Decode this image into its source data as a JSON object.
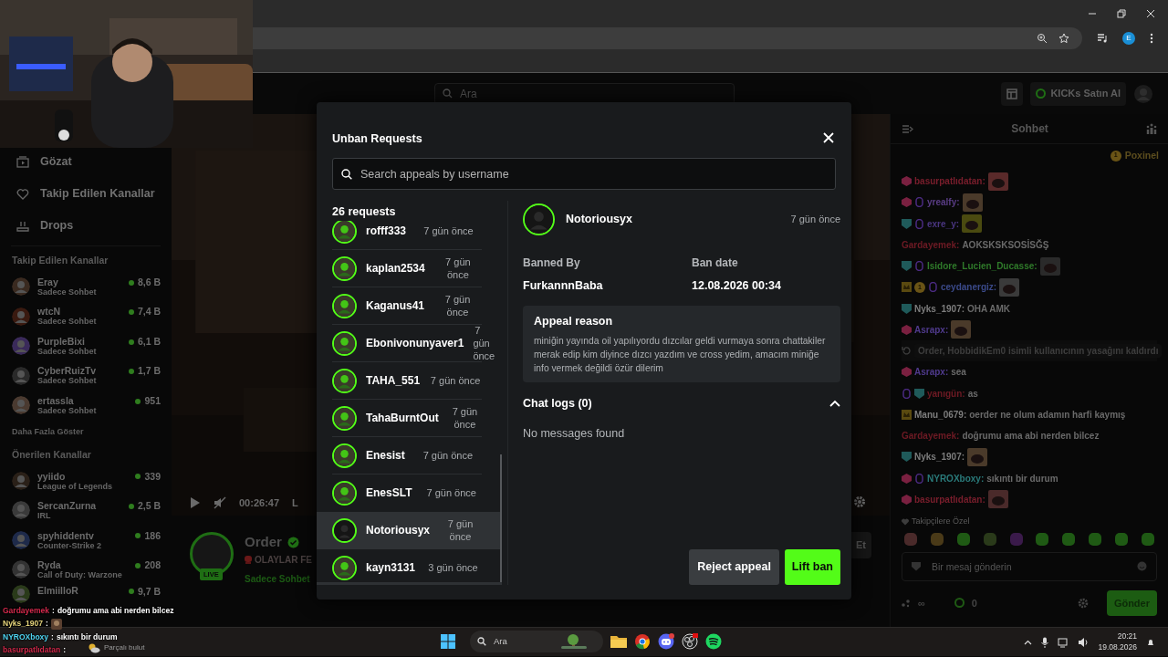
{
  "browser": {
    "profile_initial": "E"
  },
  "site_header": {
    "search_placeholder": "Ara",
    "kicks_button": "KICKs Satın Al"
  },
  "sidebar": {
    "nav": [
      {
        "kind": "browse",
        "label": "Gözat"
      },
      {
        "kind": "following",
        "label": "Takip Edilen Kanallar"
      },
      {
        "kind": "drops",
        "label": "Drops"
      }
    ],
    "followed_title": "Takip Edilen Kanallar",
    "followed": [
      {
        "name": "Eray",
        "subtitle": "Sadece Sohbet",
        "viewers": "8,6 B"
      },
      {
        "name": "wtcN",
        "subtitle": "Sadece Sohbet",
        "viewers": "7,4 B"
      },
      {
        "name": "PurpleBixi",
        "subtitle": "Sadece Sohbet",
        "viewers": "6,1 B"
      },
      {
        "name": "CyberRuizTv",
        "subtitle": "Sadece Sohbet",
        "viewers": "1,7 B"
      },
      {
        "name": "ertassla",
        "subtitle": "Sadece Sohbet",
        "viewers": "951"
      }
    ],
    "show_more": "Daha Fazla Göster",
    "recommended_title": "Önerilen Kanallar",
    "recommended": [
      {
        "name": "yyiido",
        "subtitle": "League of Legends",
        "viewers": "339"
      },
      {
        "name": "SercanZurna",
        "subtitle": "IRL",
        "viewers": "2,5 B"
      },
      {
        "name": "spyhiddentv",
        "subtitle": "Counter-Strike 2",
        "viewers": "186"
      },
      {
        "name": "Ryda",
        "subtitle": "Call of Duty: Warzone",
        "viewers": "208"
      },
      {
        "name": "ElmiilloR",
        "viewers": "9,7 B"
      }
    ]
  },
  "player": {
    "time": "00:26:47",
    "live_fragment": "L"
  },
  "channel": {
    "name": "Order",
    "verified": true,
    "title": "OLAYLAR FE",
    "category": "Sadece Sohbet",
    "live_badge": "LIVE",
    "follow_fragment": "Et"
  },
  "chat": {
    "title": "Sohbet",
    "pinned": {
      "badge": "1",
      "user": "Poxinel"
    },
    "messages": [
      {
        "kind": "user",
        "badges": [
          {
            "kind": "sub"
          }
        ],
        "user": "basurpatlıdatan",
        "sep": ":",
        "color": "#7a1e2c",
        "emote": true
      },
      {
        "kind": "user",
        "badges": [
          {
            "kind": "sub"
          },
          {
            "kind": "gifter"
          }
        ],
        "user": "yrealfy",
        "sep": ":",
        "color": "#5a3d86",
        "emote": true
      },
      {
        "kind": "user",
        "badges": [
          {
            "kind": "shield"
          },
          {
            "kind": "gifter"
          }
        ],
        "user": "exre_y",
        "sep": ":",
        "color": "#4a3580",
        "emote": true
      },
      {
        "kind": "user",
        "user": "Gardayemek",
        "sep": ":",
        "color": "#6e1a24",
        "text": "AOKSKSKSOSİSĞŞ"
      },
      {
        "kind": "user",
        "badges": [
          {
            "kind": "shield"
          },
          {
            "kind": "gifter"
          }
        ],
        "user": "Isidore_Lucien_Ducasse",
        "sep": ":",
        "color": "#2f7a2a",
        "emote": true
      },
      {
        "kind": "user",
        "badges": [
          {
            "kind": "crown"
          },
          {
            "kind": "count",
            "label": "1"
          },
          {
            "kind": "gifter"
          }
        ],
        "user": "ceydanergiz",
        "sep": ":",
        "color": "#3b4a8a",
        "emote": true
      },
      {
        "kind": "user",
        "badges": [
          {
            "kind": "shield"
          }
        ],
        "user": "Nyks_1907",
        "sep": ":",
        "color": "#7d7d7d",
        "text": "OHA AMK"
      },
      {
        "kind": "user",
        "badges": [
          {
            "kind": "sub"
          }
        ],
        "user": "Asrapx",
        "sep": ":",
        "color": "#4f3a8c",
        "emote": true
      },
      {
        "kind": "system",
        "actor": "Order, HobbidikEm0",
        "text": "isimli kullanıcının yasağını kaldırdı"
      },
      {
        "kind": "user",
        "badges": [
          {
            "kind": "sub"
          }
        ],
        "user": "Asrapx",
        "sep": ":",
        "color": "#4f3a8c",
        "text": "sea"
      },
      {
        "kind": "user",
        "badges": [
          {
            "kind": "gifter"
          },
          {
            "kind": "shield"
          }
        ],
        "user": "yanıgün",
        "sep": ":",
        "color": "#6e1a24",
        "text": "as"
      },
      {
        "kind": "user",
        "badges": [
          {
            "kind": "crown"
          }
        ],
        "user": "Manu_0679",
        "sep": ":",
        "color": "#7d7d7d",
        "text": "oerder ne olum adamın harfi kaymış"
      },
      {
        "kind": "user",
        "user": "Gardayemek",
        "sep": ":",
        "color": "#6e1a24",
        "text": "doğrumu ama abi nerden bilcez"
      },
      {
        "kind": "user",
        "badges": [
          {
            "kind": "shield"
          }
        ],
        "user": "Nyks_1907",
        "sep": ":",
        "color": "#7d7d7d",
        "emote": true
      },
      {
        "kind": "user",
        "badges": [
          {
            "kind": "sub"
          },
          {
            "kind": "gifter"
          }
        ],
        "user": "NYROXboxy",
        "sep": ":",
        "color": "#2a7a7a",
        "text": "sıkıntı bir durum"
      },
      {
        "kind": "user",
        "badges": [
          {
            "kind": "sub"
          }
        ],
        "user": "basurpatlıdatan",
        "sep": ":",
        "color": "#7a1e2c",
        "emote": true
      }
    ],
    "emote_section": "Takipçilere Özel",
    "input_placeholder": "Bir mesaj gönderin",
    "infinity": "∞",
    "points": "0",
    "send_button": "Gönder"
  },
  "modal": {
    "title": "Unban Requests",
    "search_placeholder": "Search appeals by username",
    "count": "26 requests",
    "requests": [
      {
        "user": "rofff333",
        "time": "7 gün önce",
        "selected": false
      },
      {
        "user": "kaplan2534",
        "time": "7 gün önce",
        "selected": false
      },
      {
        "user": "Kaganus41",
        "time": "7 gün önce",
        "selected": false
      },
      {
        "user": "Ebonivonunyaver1",
        "time": "7 gün önce",
        "selected": false
      },
      {
        "user": "TAHA_551",
        "time": "7 gün önce",
        "selected": false
      },
      {
        "user": "TahaBurntOut",
        "time": "7 gün önce",
        "selected": false
      },
      {
        "user": "Enesist",
        "time": "7 gün önce",
        "selected": false
      },
      {
        "user": "EnesSLT",
        "time": "7 gün önce",
        "selected": false
      },
      {
        "user": "Notoriousyx",
        "time": "7 gün önce",
        "selected": true
      },
      {
        "user": "kayn3131",
        "time": "3 gün önce",
        "selected": false
      }
    ],
    "detail": {
      "user": "Notoriousyx",
      "time": "7 gün önce",
      "banned_by_label": "Banned By",
      "banned_by": "FurkannnBaba",
      "ban_date_label": "Ban date",
      "ban_date": "12.08.2026 00:34",
      "appeal_title": "Appeal reason",
      "appeal_text": "miniğin yayında oil yapılıyordu dızcılar geldi vurmaya sonra chattakiler merak edip kim diyince dızcı yazdım ve cross yedim, amacım miniğe info vermek değildi özür dilerim",
      "chat_logs_title": "Chat logs (0)",
      "chat_logs_expanded": true,
      "chat_logs_empty": "No messages found"
    },
    "reject_button": "Reject appeal",
    "lift_button": "Lift ban"
  },
  "stream_overlay": {
    "messages": [
      {
        "user": "Gardayemek",
        "sep": ":",
        "color": "#d1294b",
        "text": "doğrumu ama abi nerden bilcez"
      },
      {
        "user": "Nyks_1907",
        "sep": ":",
        "color": "#e3d27a",
        "emote": true
      },
      {
        "user": "NYROXboxy",
        "sep": ":",
        "color": "#4fd4f0",
        "text": "sıkıntı bir durum"
      },
      {
        "user": "basurpatlıdatan",
        "sep": ":",
        "color": "#d1294b"
      }
    ]
  },
  "taskbar": {
    "weather": "Parçalı bulut",
    "search_placeholder": "Ara",
    "time": "20:21",
    "date": "19.08.2026"
  }
}
